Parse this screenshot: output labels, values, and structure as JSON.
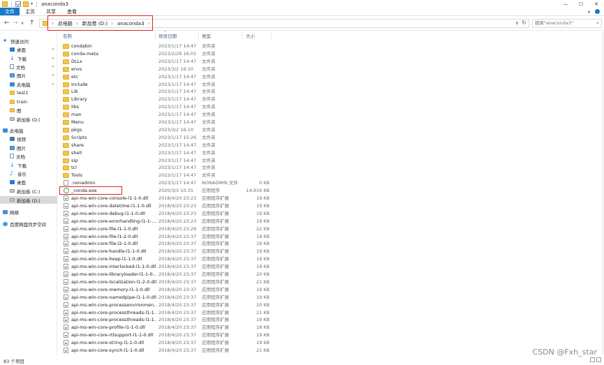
{
  "window": {
    "title": "anaconda3",
    "controls": [
      "—",
      "☐",
      "✕"
    ]
  },
  "ribbon": {
    "tabs": [
      "文件",
      "主页",
      "共享",
      "查看"
    ]
  },
  "nav": {
    "back": "←",
    "forward": "→",
    "recent": "∨",
    "up": "↑"
  },
  "address": {
    "crumbs": [
      "此电脑",
      "新加卷 (D:)",
      "anaconda3"
    ],
    "separator": "›",
    "dropdown": "∨",
    "refresh": "↻"
  },
  "search": {
    "placeholder": "搜索\"anaconda3\""
  },
  "sidebar": {
    "items": [
      {
        "label": "快速访问",
        "icon": "star-icon",
        "pinned": false
      },
      {
        "label": "桌面",
        "icon": "desktop-icon",
        "pinned": true
      },
      {
        "label": "下载",
        "icon": "download-icon",
        "pinned": true
      },
      {
        "label": "文档",
        "icon": "document-icon",
        "pinned": true
      },
      {
        "label": "图片",
        "icon": "picture-icon",
        "pinned": true
      },
      {
        "label": "此电脑",
        "icon": "computer-icon",
        "pinned": true
      },
      {
        "label": "test1",
        "icon": "folder-icon",
        "pinned": false
      },
      {
        "label": "train",
        "icon": "folder-icon",
        "pinned": false
      },
      {
        "label": "图",
        "icon": "folder-icon",
        "pinned": false
      },
      {
        "label": "新加卷 (D:)",
        "icon": "drive-icon",
        "pinned": false
      },
      {
        "label": "此电脑",
        "icon": "computer-icon",
        "pinned": false
      },
      {
        "label": "视频",
        "icon": "video-icon",
        "pinned": false
      },
      {
        "label": "图片",
        "icon": "picture-icon",
        "pinned": false
      },
      {
        "label": "文档",
        "icon": "document-icon",
        "pinned": false
      },
      {
        "label": "下载",
        "icon": "download-icon",
        "pinned": false
      },
      {
        "label": "音乐",
        "icon": "music-icon",
        "pinned": false
      },
      {
        "label": "桌面",
        "icon": "desktop-icon",
        "pinned": false
      },
      {
        "label": "新加卷 (C:)",
        "icon": "drive-icon",
        "pinned": false
      },
      {
        "label": "新加卷 (D:)",
        "icon": "drive-icon",
        "pinned": false,
        "selected": true
      },
      {
        "label": "网络",
        "icon": "network-icon",
        "pinned": false
      },
      {
        "label": "百度网盘同步空间",
        "icon": "cloud-icon",
        "pinned": false
      }
    ]
  },
  "columns": {
    "name": "名称",
    "date": "修改日期",
    "type": "类型",
    "size": "大小"
  },
  "files": [
    {
      "name": "condabin",
      "date": "2023/1/17 14:47",
      "type": "文件夹",
      "size": "",
      "kind": "folder"
    },
    {
      "name": "conda-meta",
      "date": "2023/2/28 16:01",
      "type": "文件夹",
      "size": "",
      "kind": "folder"
    },
    {
      "name": "DLLs",
      "date": "2023/1/17 14:47",
      "type": "文件夹",
      "size": "",
      "kind": "folder"
    },
    {
      "name": "envs",
      "date": "2023/3/2 16:10",
      "type": "文件夹",
      "size": "",
      "kind": "folder"
    },
    {
      "name": "etc",
      "date": "2023/1/17 14:47",
      "type": "文件夹",
      "size": "",
      "kind": "folder"
    },
    {
      "name": "include",
      "date": "2023/1/17 14:47",
      "type": "文件夹",
      "size": "",
      "kind": "folder"
    },
    {
      "name": "Lib",
      "date": "2023/1/17 14:47",
      "type": "文件夹",
      "size": "",
      "kind": "folder"
    },
    {
      "name": "Library",
      "date": "2023/1/17 14:47",
      "type": "文件夹",
      "size": "",
      "kind": "folder"
    },
    {
      "name": "libs",
      "date": "2023/1/17 14:47",
      "type": "文件夹",
      "size": "",
      "kind": "folder"
    },
    {
      "name": "man",
      "date": "2023/1/17 14:47",
      "type": "文件夹",
      "size": "",
      "kind": "folder"
    },
    {
      "name": "Menu",
      "date": "2023/1/17 14:47",
      "type": "文件夹",
      "size": "",
      "kind": "folder"
    },
    {
      "name": "pkgs",
      "date": "2023/3/2 16:10",
      "type": "文件夹",
      "size": "",
      "kind": "folder"
    },
    {
      "name": "Scripts",
      "date": "2023/1/17 15:26",
      "type": "文件夹",
      "size": "",
      "kind": "folder"
    },
    {
      "name": "share",
      "date": "2023/1/17 14:47",
      "type": "文件夹",
      "size": "",
      "kind": "folder"
    },
    {
      "name": "shell",
      "date": "2023/1/17 14:47",
      "type": "文件夹",
      "size": "",
      "kind": "folder"
    },
    {
      "name": "sip",
      "date": "2023/1/17 14:47",
      "type": "文件夹",
      "size": "",
      "kind": "folder"
    },
    {
      "name": "tcl",
      "date": "2023/1/17 14:47",
      "type": "文件夹",
      "size": "",
      "kind": "folder"
    },
    {
      "name": "Tools",
      "date": "2023/1/17 14:47",
      "type": "文件夹",
      "size": "",
      "kind": "folder"
    },
    {
      "name": ".nonadmin",
      "date": "2023/1/17 14:47",
      "type": "NONADMIN 文件",
      "size": "0 KB",
      "kind": "file"
    },
    {
      "name": "_conda.exe",
      "date": "2020/3/3 10:31",
      "type": "应用程序",
      "size": "14,919 KB",
      "kind": "exe"
    },
    {
      "name": "api-ms-win-core-console-l1-1-0.dll",
      "date": "2018/4/20 23:23",
      "type": "应用程序扩展",
      "size": "19 KB",
      "kind": "dll"
    },
    {
      "name": "api-ms-win-core-datetime-l1-1-0.dll",
      "date": "2018/4/20 23:23",
      "type": "应用程序扩展",
      "size": "19 KB",
      "kind": "dll"
    },
    {
      "name": "api-ms-win-core-debug-l1-1-0.dll",
      "date": "2018/4/20 23:23",
      "type": "应用程序扩展",
      "size": "19 KB",
      "kind": "dll"
    },
    {
      "name": "api-ms-win-core-errorhandling-l1-1-...",
      "date": "2018/4/20 23:23",
      "type": "应用程序扩展",
      "size": "19 KB",
      "kind": "dll"
    },
    {
      "name": "api-ms-win-core-file-l1-1-0.dll",
      "date": "2018/4/20 23:29",
      "type": "应用程序扩展",
      "size": "22 KB",
      "kind": "dll"
    },
    {
      "name": "api-ms-win-core-file-l1-2-0.dll",
      "date": "2018/4/20 23:37",
      "type": "应用程序扩展",
      "size": "19 KB",
      "kind": "dll"
    },
    {
      "name": "api-ms-win-core-file-l2-1-0.dll",
      "date": "2018/4/20 23:37",
      "type": "应用程序扩展",
      "size": "19 KB",
      "kind": "dll"
    },
    {
      "name": "api-ms-win-core-handle-l1-1-0.dll",
      "date": "2018/4/20 23:37",
      "type": "应用程序扩展",
      "size": "19 KB",
      "kind": "dll"
    },
    {
      "name": "api-ms-win-core-heap-l1-1-0.dll",
      "date": "2018/4/20 23:37",
      "type": "应用程序扩展",
      "size": "19 KB",
      "kind": "dll"
    },
    {
      "name": "api-ms-win-core-interlocked-l1-1-0.dll",
      "date": "2018/4/20 23:37",
      "type": "应用程序扩展",
      "size": "19 KB",
      "kind": "dll"
    },
    {
      "name": "api-ms-win-core-libraryloader-l1-1-0...",
      "date": "2018/4/20 23:37",
      "type": "应用程序扩展",
      "size": "20 KB",
      "kind": "dll"
    },
    {
      "name": "api-ms-win-core-localization-l1-2-0.dll",
      "date": "2018/4/20 23:37",
      "type": "应用程序扩展",
      "size": "21 KB",
      "kind": "dll"
    },
    {
      "name": "api-ms-win-core-memory-l1-1-0.dll",
      "date": "2018/4/20 23:37",
      "type": "应用程序扩展",
      "size": "19 KB",
      "kind": "dll"
    },
    {
      "name": "api-ms-win-core-namedpipe-l1-1-0.dll",
      "date": "2018/4/20 23:37",
      "type": "应用程序扩展",
      "size": "19 KB",
      "kind": "dll"
    },
    {
      "name": "api-ms-win-core-processenvironmen...",
      "date": "2018/4/20 23:37",
      "type": "应用程序扩展",
      "size": "20 KB",
      "kind": "dll"
    },
    {
      "name": "api-ms-win-core-processthreads-l1-1...",
      "date": "2018/4/20 23:37",
      "type": "应用程序扩展",
      "size": "21 KB",
      "kind": "dll"
    },
    {
      "name": "api-ms-win-core-processthreads-l1-1...",
      "date": "2018/4/20 23:37",
      "type": "应用程序扩展",
      "size": "19 KB",
      "kind": "dll"
    },
    {
      "name": "api-ms-win-core-profile-l1-1-0.dll",
      "date": "2018/4/20 23:37",
      "type": "应用程序扩展",
      "size": "18 KB",
      "kind": "dll"
    },
    {
      "name": "api-ms-win-core-rtlsupport-l1-1-0.dll",
      "date": "2018/4/20 23:37",
      "type": "应用程序扩展",
      "size": "19 KB",
      "kind": "dll"
    },
    {
      "name": "api-ms-win-core-string-l1-1-0.dll",
      "date": "2018/4/20 23:37",
      "type": "应用程序扩展",
      "size": "19 KB",
      "kind": "dll"
    },
    {
      "name": "api-ms-win-core-synch-l1-1-0.dll",
      "date": "2018/4/20 23:37",
      "type": "应用程序扩展",
      "size": "21 KB",
      "kind": "dll"
    }
  ],
  "status": {
    "count": "83 个项目"
  },
  "watermark": "CSDN @Fxh_star",
  "colors": {
    "file_tab": "#1979ca",
    "highlight_box": "#e0232a",
    "folder": "#f3c64a",
    "selection": "#d9d9d9"
  }
}
